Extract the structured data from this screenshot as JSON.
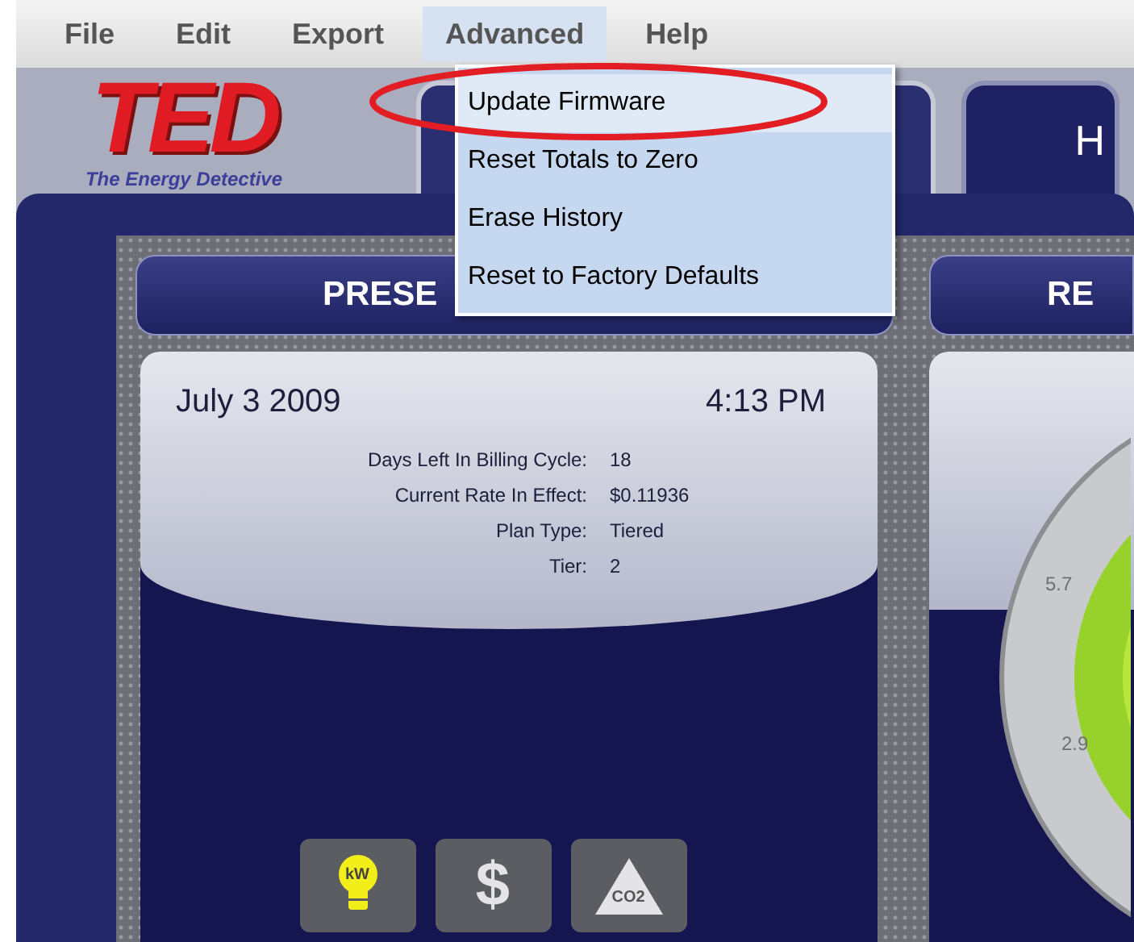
{
  "menu_bar": [
    {
      "label": "File",
      "selected": false
    },
    {
      "label": "Edit",
      "selected": false
    },
    {
      "label": "Export",
      "selected": false
    },
    {
      "label": "Advanced",
      "selected": true
    },
    {
      "label": "Help",
      "selected": false
    }
  ],
  "dropdown": [
    {
      "label": "Update Firmware",
      "selected": true
    },
    {
      "label": "Reset Totals to Zero",
      "selected": false
    },
    {
      "label": "Erase History",
      "selected": false
    },
    {
      "label": "Reset to Factory Defaults",
      "selected": false
    }
  ],
  "logo": {
    "title": "TED",
    "tagline": "The Energy Detective"
  },
  "tabs": [
    {
      "selected": true
    },
    {
      "label": "H",
      "selected": false
    }
  ],
  "left_panel": {
    "header": "PRESE",
    "date": "July 3 2009",
    "time": "4:13 PM",
    "details": [
      {
        "label": "Days Left In Billing Cycle:",
        "value": "18"
      },
      {
        "label": "Current Rate In Effect:",
        "value": "$0.11936"
      },
      {
        "label": "Plan Type:",
        "value": "Tiered"
      },
      {
        "label": "Tier:",
        "value": "2"
      }
    ],
    "modes": [
      {
        "kind": "kw",
        "label": "kW",
        "selected": true
      },
      {
        "kind": "cost",
        "label": "$",
        "selected": false
      },
      {
        "kind": "co2",
        "label": "CO2",
        "selected": false
      }
    ]
  },
  "right_panel": {
    "header": "RE",
    "gauge_labels": [
      "5.7",
      "2.9"
    ]
  }
}
